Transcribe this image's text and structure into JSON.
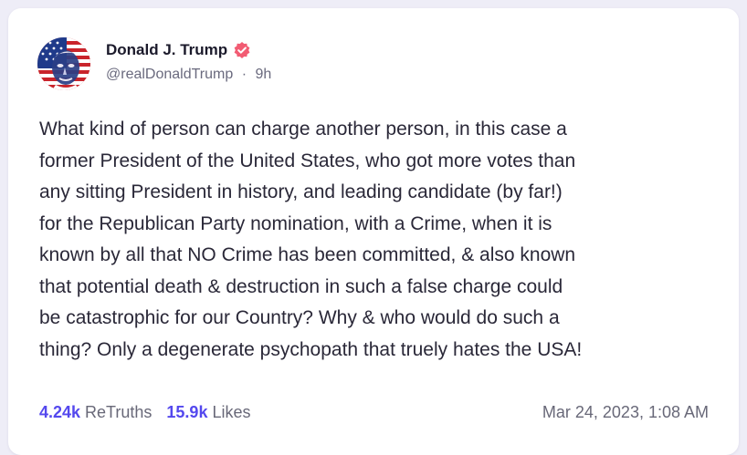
{
  "post": {
    "author": {
      "display_name": "Donald J. Trump",
      "handle": "@realDonaldTrump",
      "separator": "·",
      "relative_time": "9h",
      "verified": true,
      "verified_badge_color": "#f25c73",
      "avatar_icon": "avatar-flag-portrait"
    },
    "text": "What kind of person can charge another person, in this case a\nformer President of the United States, who got more votes than\nany sitting President in history, and leading candidate (by far!)\nfor the Republican Party nomination, with a Crime, when it is\nknown by all that NO Crime has been committed, & also known\nthat potential death & destruction in such a false charge could\nbe catastrophic for our Country? Why & who would do such a\nthing? Only a degenerate psychopath that truely hates the USA!",
    "stats": {
      "retruths_count": "4.24k",
      "retruths_label": "ReTruths",
      "likes_count": "15.9k",
      "likes_label": "Likes"
    },
    "timestamp": "Mar 24, 2023, 1:08 AM"
  },
  "colors": {
    "accent": "#5448ee",
    "page_background": "#eeedf7",
    "card_background": "#ffffff",
    "primary_text": "#1b1a2b",
    "secondary_text": "#686878"
  }
}
